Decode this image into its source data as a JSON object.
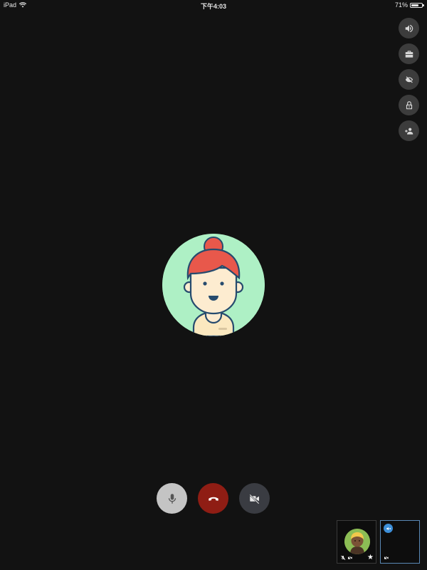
{
  "status_bar": {
    "device": "iPad",
    "time": "下午4:03",
    "battery": "71%",
    "battery_level": 0.71
  },
  "side_controls": [
    {
      "icon": "speaker-icon"
    },
    {
      "icon": "briefcase-icon"
    },
    {
      "icon": "eye-off-icon"
    },
    {
      "icon": "lock-icon"
    },
    {
      "icon": "add-person-icon"
    }
  ],
  "call_controls": {
    "mic": {
      "icon": "microphone-icon",
      "color": "#c4c4c4"
    },
    "hangup": {
      "icon": "phone-hangup-icon",
      "color": "#8f1d14"
    },
    "camera": {
      "icon": "camera-off-icon",
      "color": "#3a3c42"
    }
  },
  "participants": [
    {
      "icon": "avatar",
      "muted": true,
      "video_off": true,
      "starred": true
    },
    {
      "icon": "megaphone-icon",
      "video_off": true,
      "selected": true
    }
  ],
  "colors": {
    "background": "#121212",
    "main_avatar_bg": "#aef0c5",
    "hair": "#e8584b",
    "thumb_avatar_bg": "#8cbd55",
    "badge": "#3d8fd9"
  }
}
